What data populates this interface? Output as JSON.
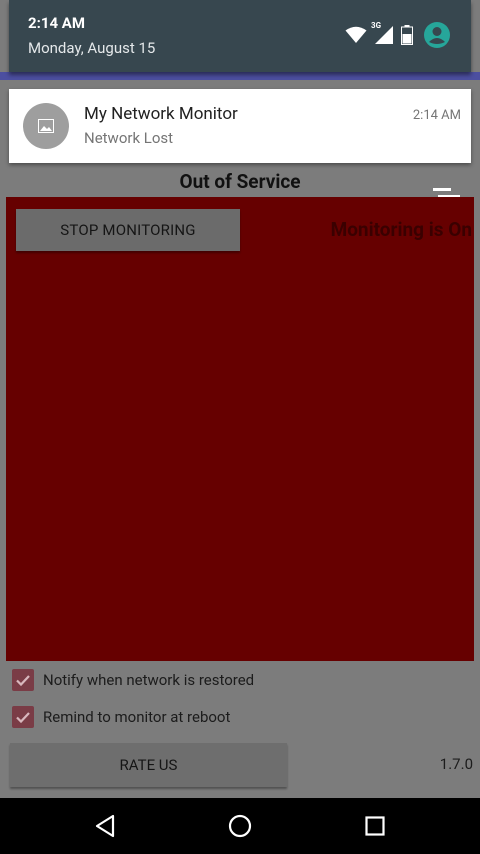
{
  "status_header": {
    "time": "2:14 AM",
    "date": "Monday, August 15",
    "network_type": "3G",
    "icons": [
      "wifi-icon",
      "cellular-signal-icon",
      "battery-icon",
      "user-avatar-icon"
    ]
  },
  "notification": {
    "app_name": "My Network Monitor",
    "message": "Network Lost",
    "time": "2:14 AM",
    "icon": "image-placeholder-icon"
  },
  "app": {
    "title": "Out of Service",
    "stop_button_label": "STOP MONITORING",
    "monitoring_status": "Monitoring is On",
    "options": [
      {
        "label": "Notify when network is restored",
        "checked": true
      },
      {
        "label": "Remind to monitor at reboot",
        "checked": true
      }
    ],
    "rate_button_label": "RATE US",
    "version": "1.7.0",
    "colors": {
      "alert_panel": "#660000",
      "checkbox": "#7a3c46",
      "shade_header": "#37474f",
      "accent_avatar": "#26a69a"
    }
  },
  "navigation": {
    "icons": [
      "back-icon",
      "home-icon",
      "recents-icon"
    ]
  }
}
